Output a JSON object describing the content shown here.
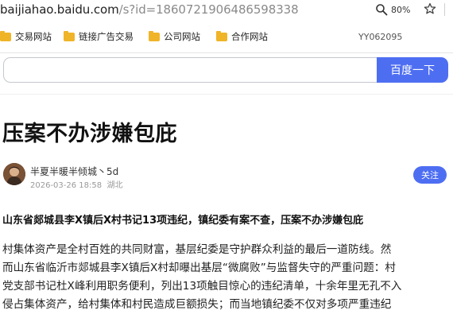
{
  "browser": {
    "url_host": "baijiahao.baidu.com",
    "url_path": "/s?id=1860721906486598338",
    "zoom": "80%"
  },
  "bookmarks": {
    "items": [
      "交易网站",
      "链接广告交易",
      "公司网站",
      "合作网站"
    ],
    "user": "YY062095"
  },
  "search": {
    "button_label": "百度一下",
    "placeholder": ""
  },
  "article": {
    "title": "压案不办涉嫌包庇",
    "author_name": "半夏半暖半倾城丶5d",
    "publish_time": "2026-03-26 18:58",
    "region": "湖北",
    "follow_label": "关注",
    "lead": "山东省郯城县李X镇后X村书记13项违纪，镇纪委有案不查，压案不办涉嫌包庇",
    "body_lines": [
      "村集体资产是全村百姓的共同财富，基层纪委是守护群众利益的最后一道防线。然",
      "而山东省临沂市郯城县李X镇后X村却曝出基层“微腐败”与监督失守的严重问题：村",
      "党支部书记杜X峰利用职务便利，列出13项触目惊心的违纪清单，十余年里无孔不入",
      "侵占集体资产，给村集体和村民造成巨额损失；而当地镇纪委不仅对多项严重违纪"
    ]
  },
  "colors": {
    "accent": "#4e6ef2",
    "folder": "#f0b429"
  }
}
